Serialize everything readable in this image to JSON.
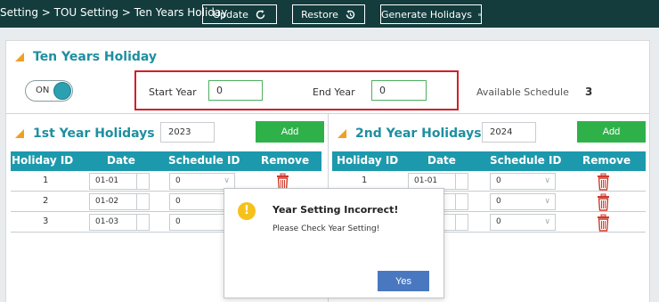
{
  "topbar": {
    "breadcrumb": "Setting > TOU Setting > Ten Years Holiday",
    "update_label": "Update",
    "restore_label": "Restore",
    "generate_label": "Generate Holidays"
  },
  "panel": {
    "title": "Ten Years Holiday",
    "toggle_label": "ON",
    "toggle_on": true,
    "start_year_label": "Start Year",
    "start_year_value": "0",
    "end_year_label": "End Year",
    "end_year_value": "0",
    "available_schedule_label": "Available Schedule",
    "available_schedule_value": "3"
  },
  "year1": {
    "title": "1st Year Holidays",
    "year": "2023",
    "add_label": "Add",
    "columns": [
      "Holiday ID",
      "Date",
      "Schedule ID",
      "Remove"
    ],
    "rows": [
      {
        "id": "1",
        "date": "01-01",
        "schedule": "0"
      },
      {
        "id": "2",
        "date": "01-02",
        "schedule": "0"
      },
      {
        "id": "3",
        "date": "01-03",
        "schedule": "0"
      }
    ]
  },
  "year2": {
    "title": "2nd Year Holidays",
    "year": "2024",
    "add_label": "Add",
    "columns": [
      "Holiday ID",
      "Date",
      "Schedule ID",
      "Remove"
    ],
    "rows": [
      {
        "id": "1",
        "date": "01-01",
        "schedule": "0"
      },
      {
        "id": "",
        "date": "",
        "schedule": "0"
      },
      {
        "id": "",
        "date": "",
        "schedule": "0"
      }
    ]
  },
  "dialog": {
    "title": "Year Setting Incorrect!",
    "message": "Please Check Year Setting!",
    "yes_label": "Yes"
  },
  "colors": {
    "topbar": "#143c3c",
    "accent_teal": "#1d99ad",
    "add_green": "#2fb14a",
    "highlight_red": "#d21f2a",
    "remove_red": "#d0392b",
    "warning_yellow": "#f6c11b",
    "yes_blue": "#4a78c0"
  }
}
